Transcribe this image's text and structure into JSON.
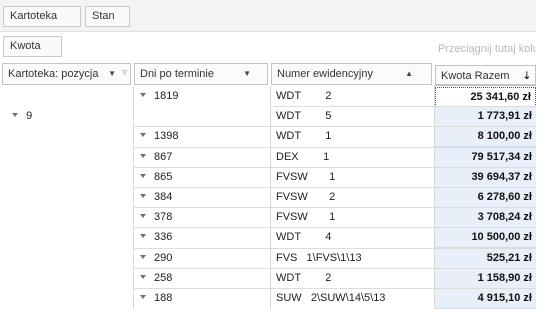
{
  "filter_area": {
    "fields": [
      "Kartoteka",
      "Stan"
    ]
  },
  "data_area": {
    "field": "Kwota",
    "drop_hint": "Przeciągnij tutaj kolumny"
  },
  "headers": {
    "kartoteka": "Kartoteka: pozycja",
    "dni": "Dni po terminie",
    "numer": "Numer ewidencyjny",
    "kwota": "Kwota Razem"
  },
  "group": {
    "kartoteka": "9"
  },
  "rows": [
    {
      "dni": "1819",
      "numer": "WDT        2",
      "kwota": "25 341,60 zł",
      "show_dni": true
    },
    {
      "dni": "",
      "numer": "WDT        5",
      "kwota": "1 773,91 zł",
      "show_dni": false
    },
    {
      "dni": "1398",
      "numer": "WDT        1",
      "kwota": "8 100,00 zł",
      "show_dni": true
    },
    {
      "dni": "867",
      "numer": "DEX        1",
      "kwota": "79 517,34 zł",
      "show_dni": true
    },
    {
      "dni": "865",
      "numer": "FVSW       1",
      "kwota": "39 694,37 zł",
      "show_dni": true
    },
    {
      "dni": "384",
      "numer": "FVSW       2",
      "kwota": "6 278,60 zł",
      "show_dni": true
    },
    {
      "dni": "378",
      "numer": "FVSW       1",
      "kwota": "3 708,24 zł",
      "show_dni": true
    },
    {
      "dni": "336",
      "numer": "WDT        4",
      "kwota": "10 500,00 zł",
      "show_dni": true
    },
    {
      "dni": "290",
      "numer": "FVS   1\\FVS\\1\\13",
      "kwota": "525,21 zł",
      "show_dni": true
    },
    {
      "dni": "258",
      "numer": "WDT        2",
      "kwota": "1 158,90 zł",
      "show_dni": true
    },
    {
      "dni": "188",
      "numer": "SUW   2\\SUW\\14\\5\\13",
      "kwota": "4 915,10 zł",
      "show_dni": true
    }
  ]
}
